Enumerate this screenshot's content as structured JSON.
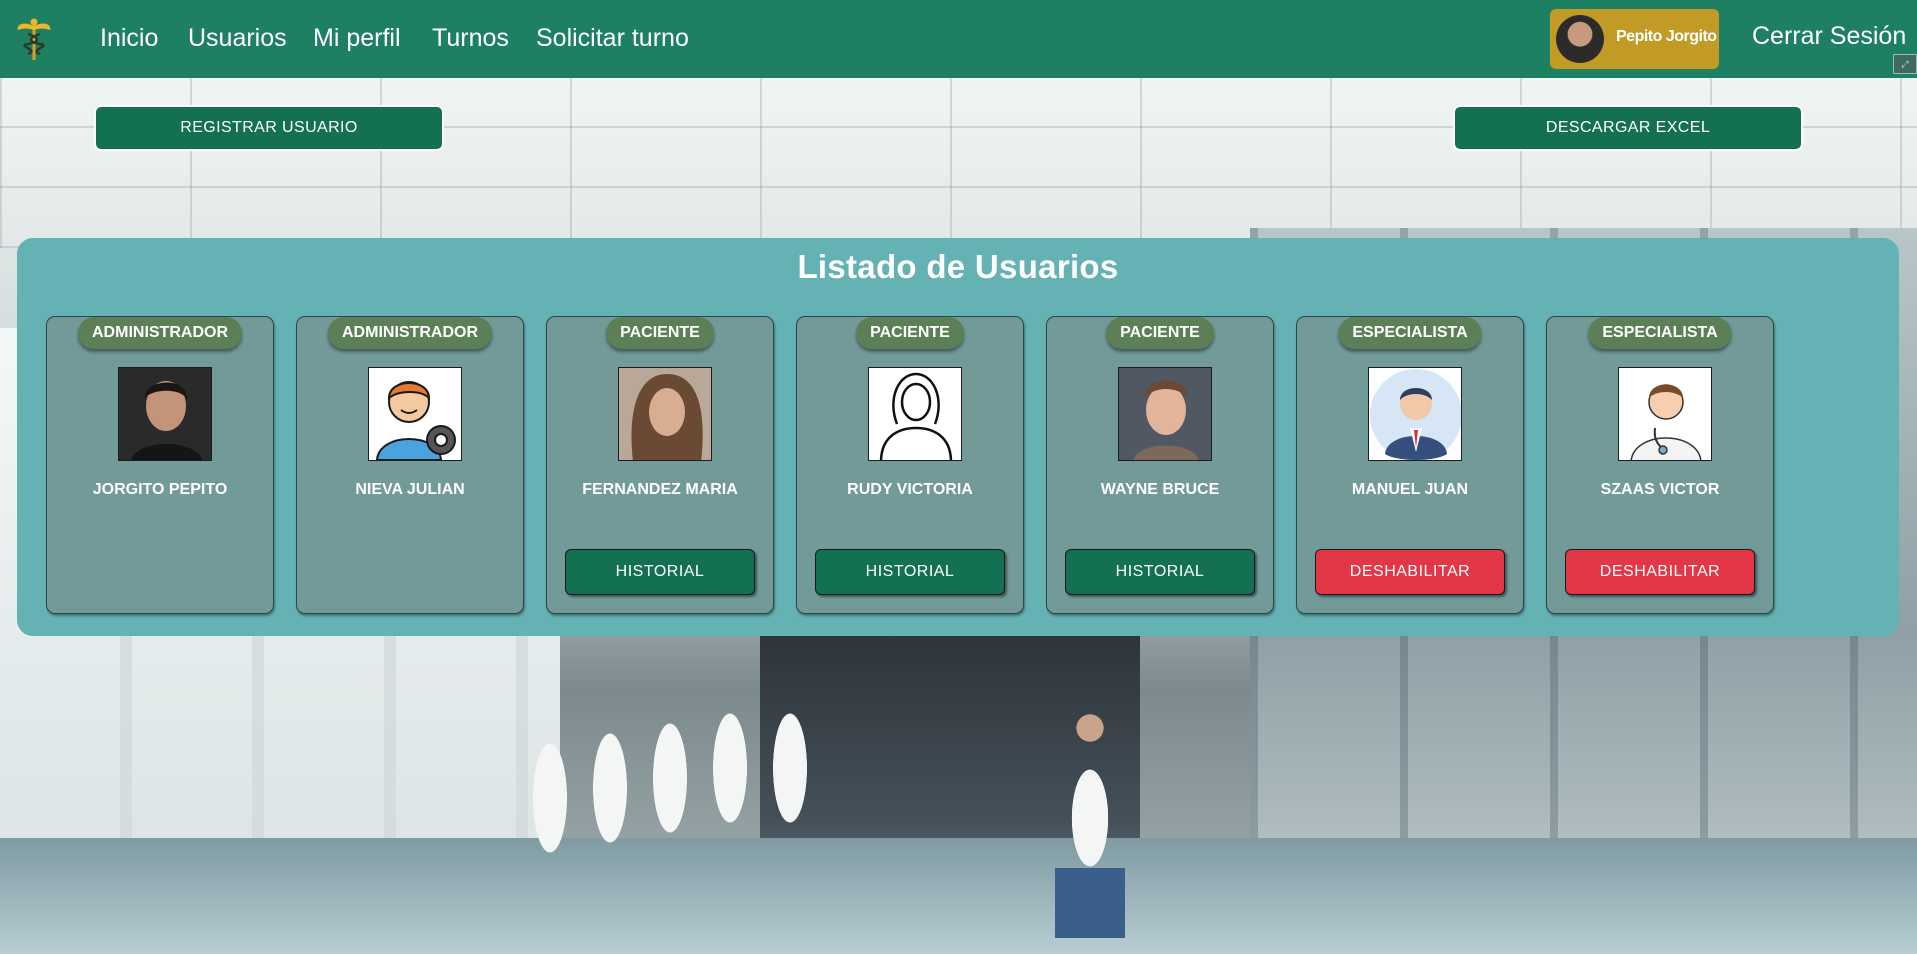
{
  "nav": {
    "logo_icon": "caduceus-icon",
    "links": [
      "Inicio",
      "Usuarios",
      "Mi perfil",
      "Turnos",
      "Solicitar turno"
    ],
    "profile_name": "Pepito Jorgito",
    "logout": "Cerrar Sesión"
  },
  "actions": {
    "register": "REGISTRAR USUARIO",
    "excel": "DESCARGAR EXCEL"
  },
  "panel": {
    "title": "Listado de Usuarios",
    "users": [
      {
        "role": "ADMINISTRADOR",
        "name": "JORGITO PEPITO",
        "photo": "man-portrait-photo",
        "button": ""
      },
      {
        "role": "ADMINISTRADOR",
        "name": "NIEVA JULIAN",
        "photo": "admin-gear-icon",
        "button": ""
      },
      {
        "role": "PACIENTE",
        "name": "FERNANDEZ MARIA",
        "photo": "woman-portrait-photo",
        "button": "HISTORIAL"
      },
      {
        "role": "PACIENTE",
        "name": "RUDY VICTORIA",
        "photo": "woman-outline-icon",
        "button": "HISTORIAL"
      },
      {
        "role": "PACIENTE",
        "name": "WAYNE BRUCE",
        "photo": "young-man-portrait-photo",
        "button": "HISTORIAL"
      },
      {
        "role": "ESPECIALISTA",
        "name": "MANUEL JUAN",
        "photo": "businessman-avatar-icon",
        "button": "DESHABILITAR"
      },
      {
        "role": "ESPECIALISTA",
        "name": "SZAAS VICTOR",
        "photo": "doctor-avatar-icon",
        "button": "DESHABILITAR"
      }
    ]
  },
  "colors": {
    "navbar": "#1e8062",
    "panel": "#64b2b4",
    "card": "#719a99",
    "role_pill": "#5c7f58",
    "green_button": "#137052",
    "red_button": "#e33646",
    "profile_chip": "#c29a26"
  }
}
